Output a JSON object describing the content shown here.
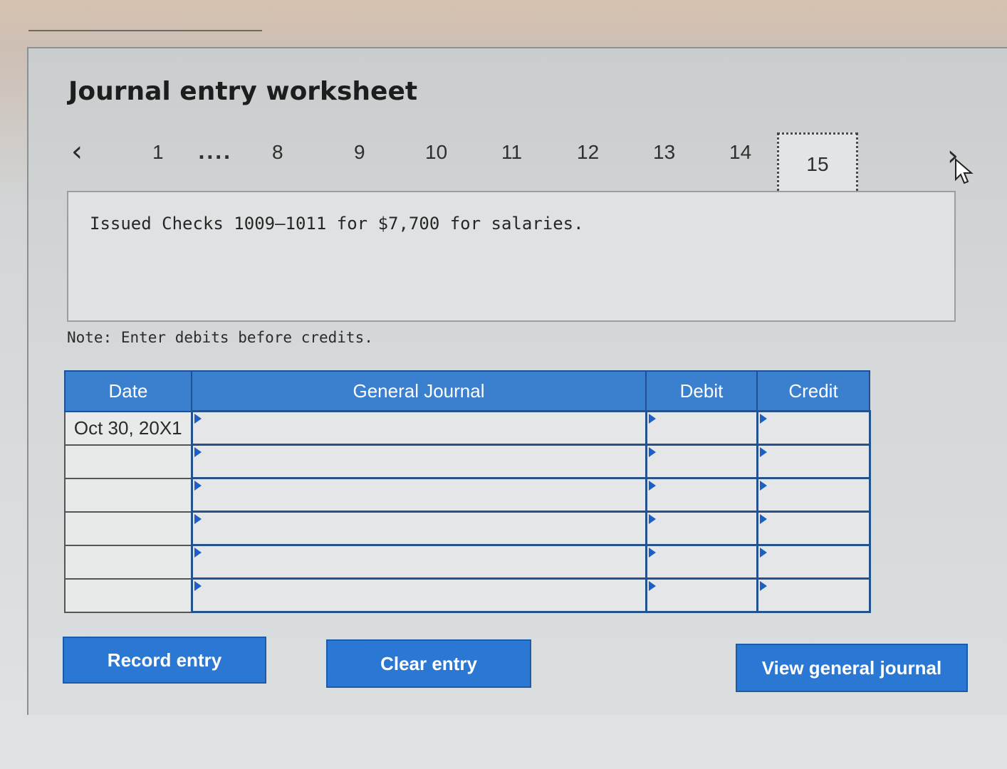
{
  "title": "Journal entry worksheet",
  "nav": {
    "prev_icon": "‹",
    "next_icon": "›",
    "pages": [
      "1",
      "8",
      "9",
      "10",
      "11",
      "12",
      "13",
      "14"
    ],
    "ellipsis": "....",
    "active_page": "15"
  },
  "description": "Issued Checks 1009–1011 for $7,700 for salaries.",
  "note": "Note: Enter debits before credits.",
  "table": {
    "headers": {
      "date": "Date",
      "general_journal": "General Journal",
      "debit": "Debit",
      "credit": "Credit"
    },
    "rows": [
      {
        "date": "Oct 30, 20X1",
        "account": "",
        "debit": "",
        "credit": ""
      },
      {
        "date": "",
        "account": "",
        "debit": "",
        "credit": ""
      },
      {
        "date": "",
        "account": "",
        "debit": "",
        "credit": ""
      },
      {
        "date": "",
        "account": "",
        "debit": "",
        "credit": ""
      },
      {
        "date": "",
        "account": "",
        "debit": "",
        "credit": ""
      },
      {
        "date": "",
        "account": "",
        "debit": "",
        "credit": ""
      }
    ]
  },
  "buttons": {
    "record": "Record entry",
    "clear": "Clear entry",
    "view": "View general journal"
  },
  "colors": {
    "header_blue": "#3b7fcf",
    "button_blue": "#2b78d4",
    "cell_border": "#24528f"
  }
}
